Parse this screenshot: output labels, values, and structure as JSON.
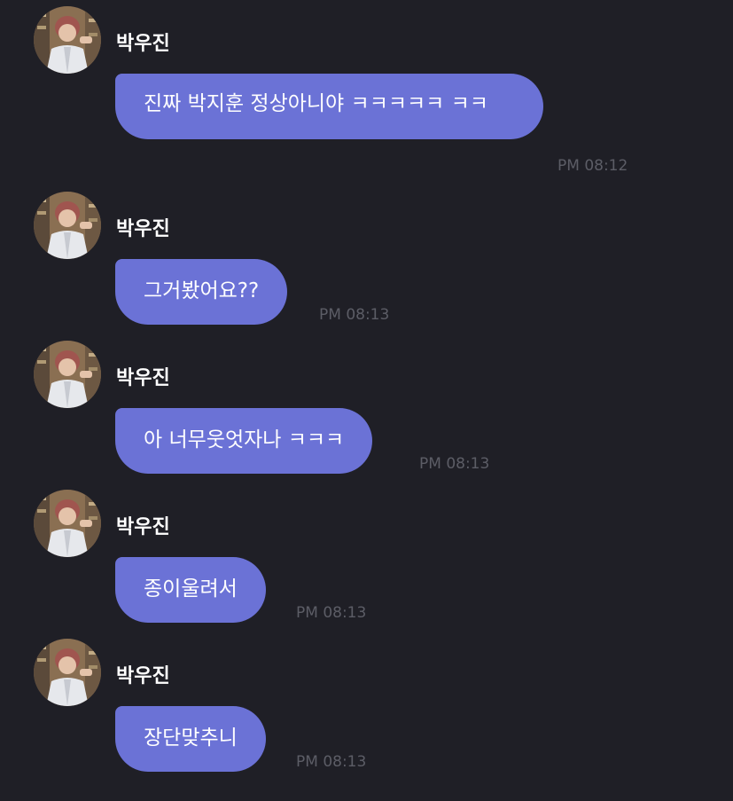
{
  "colors": {
    "background": "#1f1f26",
    "bubble": "#6b72d6",
    "text": "#ffffff",
    "timestamp": "#5c5d66"
  },
  "messages": [
    {
      "sender": "박우진",
      "text": "진짜 박지훈 정상아니야 ㅋㅋㅋㅋㅋ ㅋㅋ",
      "time": "PM 08:12"
    },
    {
      "sender": "박우진",
      "text": "그거봤어요??",
      "time": "PM 08:13"
    },
    {
      "sender": "박우진",
      "text": "아 너무웃엇자나 ㅋㅋㅋ",
      "time": "PM 08:13"
    },
    {
      "sender": "박우진",
      "text": "종이울려서",
      "time": "PM 08:13"
    },
    {
      "sender": "박우진",
      "text": "장단맞추니",
      "time": "PM 08:13"
    }
  ]
}
